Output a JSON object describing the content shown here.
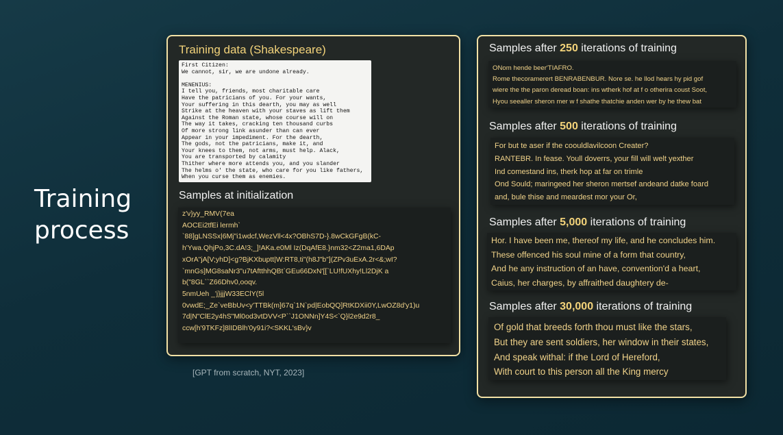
{
  "slide": {
    "title_line1": "Training",
    "title_line2": "process",
    "citation": "[GPT from scratch, NYT, 2023]"
  },
  "left_panel": {
    "training_heading": "Training data (Shakespeare)",
    "training_text": "First Citizen:\nWe cannot, sir, we are undone already.\n\nMENENIUS:\nI tell you, friends, most charitable care\nHave the patricians of you. For your wants,\nYour suffering in this dearth, you may as well\nStrike at the heaven with your staves as lift them\nAgainst the Roman state, whose course will on\nThe way it takes, cracking ten thousand curbs\nOf more strong link asunder than can ever\nAppear in your impediment. For the dearth,\nThe gods, not the patricians, make it, and\nYour knees to them, not arms, must help. Alack,\nYou are transported by calamity\nThither where more attends you, and you slander\nThe helms o' the state, who care for you like fathers,\nWhen you curse them as enemies.",
    "init_heading": "Samples at initialization",
    "init_lines": [
      "z'v}yy_RMV(7ea",
      "AOCEi2tfEi lermh`",
      "`88]gLNSSx|6Mj\"i1wdcf,WezVll<4x?OBhS7D-}.8wCkGFgB(kC-",
      "h'Ywa.QhjPo,3C.dA!3;_]!AKa.e0Ml Iz(DqAfE8.}nm32<Z2ma1,6DAp",
      "xOrA\"jA[V;yhD]<g?BjKXbuptt|W:RT8,ti\"(h8J\"b\"](ZPv3uExA.2r<&;wI?",
      "`mnGs]MG8saNr3\"u7tAftthhQBt`GEu66DxN'[[`LU!fUXhy!Ll2DjK a",
      "b(\"8GL``Z66Dhv0,ooqv.",
      "5nmUeh _'j}jjjW33EClY(5l",
      "0vwdE;_Ze`veBbUv<y'TTBk(m]67q`1N`pd|EobQQ]RtKDXii0Y,LwOZ8d'y1)u",
      "7d|N\"ClE2y4hS\"Ml0od3vtDVV<P``J1ONNn]Y4S<`Q}l2e9d2r8_",
      "ccw[h'9TKFz]8lIDBlh'0y91i?<SKKL'sBv}v"
    ]
  },
  "right_panel": {
    "sections": [
      {
        "prefix": "Samples after ",
        "number": "250",
        "suffix": " iterations of training",
        "lines": [
          "ONom hende beer'TIAFRO.",
          "Rome thecoramerert BENRABENBUR. Nore se. he llod hears hy pid gof",
          "wiere the the paron deread boan: ins wtherk hof at f o otherira coust Soot,",
          "Hyou seealler sheron mer w f shathe thatchie anden wer by he thew bat"
        ]
      },
      {
        "prefix": "Samples after ",
        "number": "500",
        "suffix": " iterations of training",
        "lines": [
          "For but te aser if the coouldlavilcoon Creater?",
          "RANTEBR. In fease. Youll doverrs, your fill will welt yexther",
          "Ind comestand ins, therk hop at far on trimle",
          "Ond Sould; maringeed her sheron mertsef andeand datke foard",
          "and, bule thise and meardest mor your Or,"
        ]
      },
      {
        "prefix": "Samples after ",
        "number": "5,000",
        "suffix": " iterations of training",
        "lines": [
          "Hor. I have been me, thereof my life, and he concludes him.",
          "These offenced his soul mine of a form that country,",
          "And he any instruction of an have, convention'd a heart,",
          "Caius, her charges, by affraithed daughtery de-"
        ]
      },
      {
        "prefix": "Samples after ",
        "number": "30,000",
        "suffix": " iterations of training",
        "lines": [
          "Of gold that breeds forth thou must like the stars,",
          "But they are sent soldiers, her window in their states,",
          "And speak withal: if the Lord of Hereford,",
          "With court to this person all the King mercy"
        ]
      }
    ]
  }
}
